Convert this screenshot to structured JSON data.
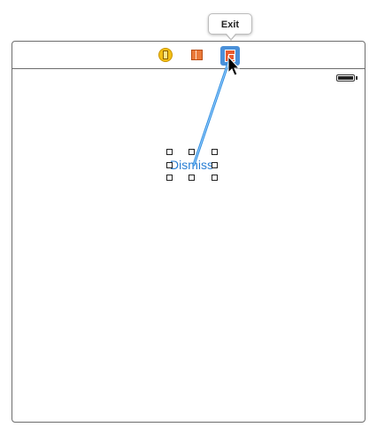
{
  "tooltip": {
    "label": "Exit"
  },
  "dock": {
    "items": [
      {
        "name": "view-controller",
        "icon": "view-controller-icon"
      },
      {
        "name": "first-responder",
        "icon": "first-responder-cube-icon"
      },
      {
        "name": "exit",
        "icon": "exit-door-icon",
        "selected": true
      }
    ]
  },
  "status_bar": {
    "battery_icon": "battery-icon"
  },
  "button": {
    "label": "Dismiss"
  },
  "connection": {
    "color": "#4aa3e8"
  },
  "colors": {
    "accent": "#2a7fd4",
    "exit_bg": "#4a90d9",
    "exit_door": "#ea5b2e"
  }
}
